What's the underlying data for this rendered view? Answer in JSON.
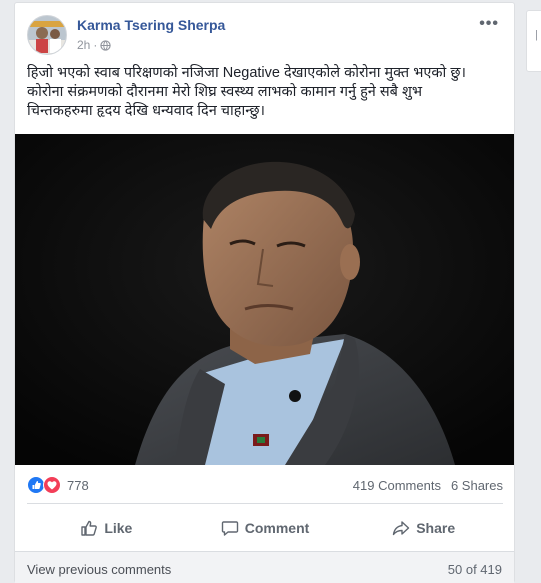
{
  "post": {
    "author": "Karma Tsering Sherpa",
    "time": "2h",
    "privacy_icon": "globe-icon",
    "text_lines": [
      "हिजो भएको स्वाब परिक्षणको नजिजा Negative देखाएकोले कोरोना मुक्त भएको छु।",
      "कोरोना संक्रमणको दौरानमा मेरो शिघ्र स्वस्थ्य लाभको कामान गर्नु हुने सबै शुभ",
      "चिन्तकहरुमा हृदय देखि धन्यवाद दिन चाहान्छु।"
    ]
  },
  "reactions": {
    "count": "778",
    "icons": [
      "like-icon",
      "love-icon"
    ]
  },
  "stats": {
    "comments": "419 Comments",
    "shares": "6 Shares"
  },
  "actions": {
    "like": "Like",
    "comment": "Comment",
    "share": "Share"
  },
  "comments": {
    "view_previous": "View previous comments",
    "page": "50 of 419"
  },
  "colors": {
    "link": "#365899",
    "like_blue": "#2078f4",
    "love_red": "#f33e58",
    "background": "#e9ebee"
  }
}
